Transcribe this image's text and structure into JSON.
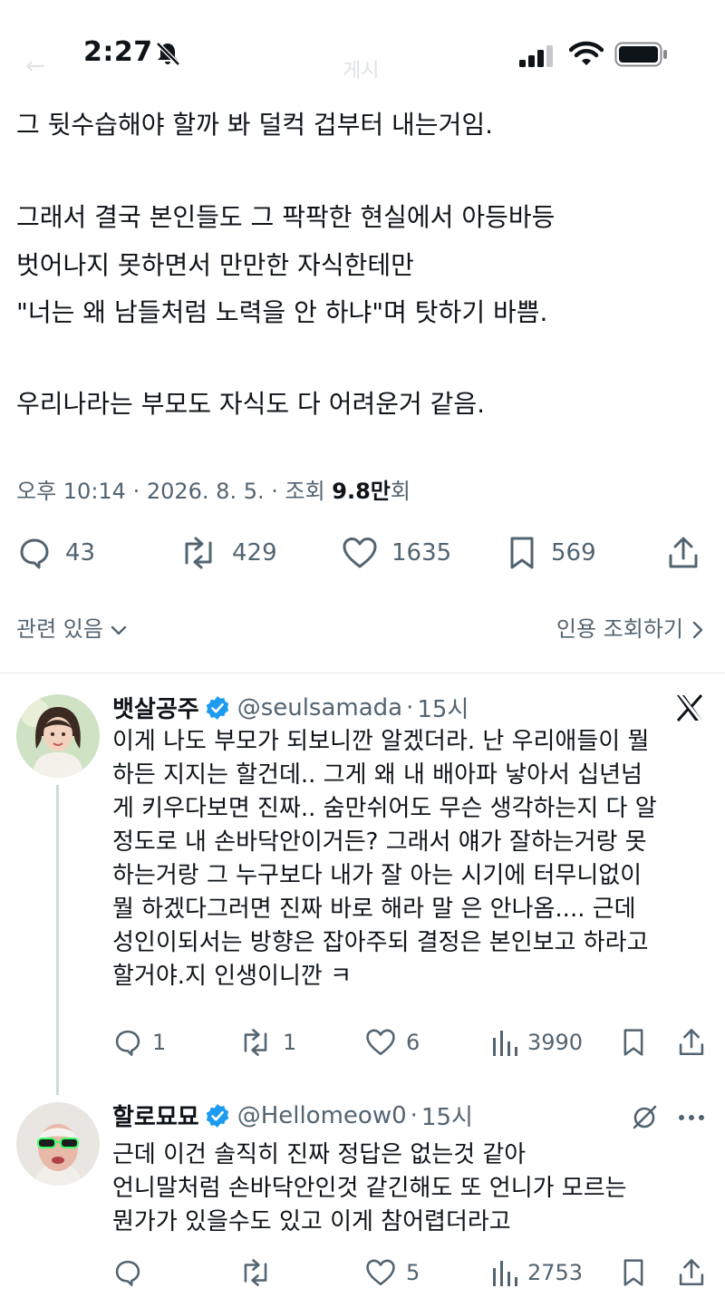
{
  "status_bar": {
    "time": "2:27"
  },
  "header": {
    "faded_title": "게시"
  },
  "tweet": {
    "lines": [
      "그 뒷수습해야 할까 봐 덜컥 겁부터 내는거임.",
      "그래서 결국 본인들도 그 팍팍한 현실에서 아등바등",
      "벗어나지 못하면서 만만한 자식한테만",
      "\"너는 왜 남들처럼 노력을 안 하냐\"며 탓하기 바쁨.",
      "우리나라는 부모도 자식도 다 어려운거 같음."
    ],
    "meta_prefix": "오후 10:14 · 2026. 8. 5. · 조회 ",
    "views": "9.8만",
    "meta_suffix": "회",
    "actions": {
      "replies": "43",
      "retweets": "429",
      "likes": "1635",
      "bookmarks": "569"
    },
    "related_label": "관련 있음",
    "quote_label": "인용 조회하기"
  },
  "replies": [
    {
      "display_name": "뱃살공주",
      "handle": "@seulsamada",
      "time": "15시",
      "lines": [
        "이게 나도 부모가 되보니깐 알겠더라. 난 우리애들이 뭘",
        "하든 지지는 할건데.. 그게 왜 내 배아파 낳아서 십년넘",
        "게 키우다보면 진짜.. 숨만쉬어도 무슨 생각하는지 다 알",
        "정도로 내 손바닥안이거든? 그래서 얘가 잘하는거랑 못",
        "하는거랑 그 누구보다 내가 잘 아는 시기에 터무니없이",
        "뭘 하겠다그러면 진짜 바로 해라 말 은 안나옴.... 근데",
        "성인이되서는 방향은 잡아주되 결정은 본인보고 하라고",
        "할거야.지 인생이니깐 ㅋ"
      ],
      "actions": {
        "replies": "1",
        "retweets": "1",
        "likes": "6",
        "views": "3990"
      }
    },
    {
      "display_name": "할로묘묘",
      "handle": "@Hellomeow0",
      "time": "15시",
      "lines": [
        "근데 이건 솔직히 진짜 정답은 없는것 같아",
        "언니말처럼 손바닥안인것 같긴해도 또 언니가 모르는",
        "뭔가가 있을수도 있고 이게 참어렵더라고"
      ],
      "actions": {
        "replies": "",
        "retweets": "",
        "likes": "5",
        "views": "2753"
      }
    }
  ],
  "colors": {
    "verified": "#1d9bf0",
    "muted": "#536471",
    "text": "#0f1419"
  }
}
